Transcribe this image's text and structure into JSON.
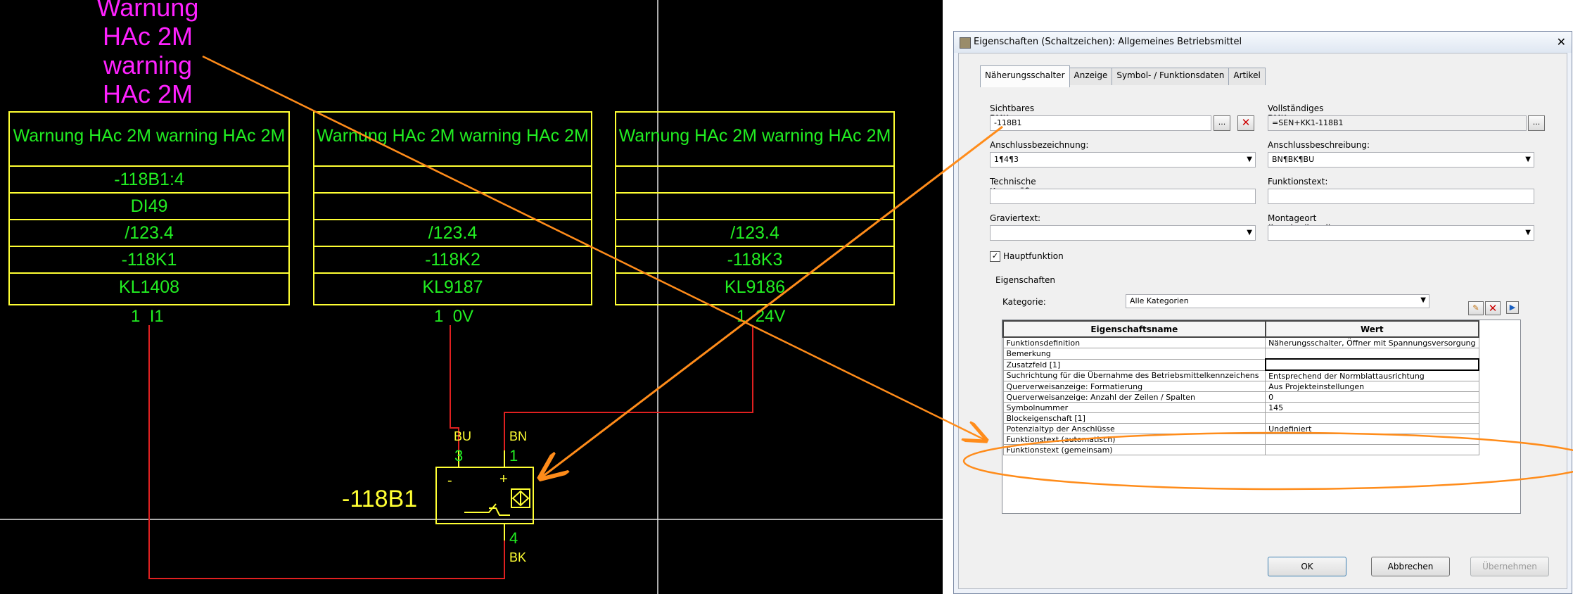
{
  "cad": {
    "warning_lines": [
      "Warnung",
      "HAc 2M",
      "warning",
      "HAc 2M"
    ],
    "terminals": [
      {
        "rows": [
          "Warnung HAc 2M warning HAc 2M",
          "-118B1:4",
          "DI49",
          "/123.4",
          "-118K1",
          "KL1408"
        ],
        "pin": "1",
        "signal": "I1"
      },
      {
        "rows": [
          "Warnung HAc 2M warning HAc 2M",
          "",
          "",
          "/123.4",
          "-118K2",
          "KL9187"
        ],
        "pin": "1",
        "signal": "0V"
      },
      {
        "rows": [
          "Warnung HAc 2M warning HAc 2M",
          "",
          "",
          "/123.4",
          "-118K3",
          "KL9186"
        ],
        "pin": "1",
        "signal": "24V"
      }
    ],
    "sensor": {
      "bmk": "-118B1",
      "minus": "-",
      "plus": "+",
      "pins": {
        "bu_label": "BU",
        "bu_num": "3",
        "bn_label": "BN",
        "bn_num": "1",
        "bk_num": "4",
        "bk_label": "BK"
      }
    },
    "colors": {
      "terminal_border": "#ffff33",
      "terminal_text": "#22ee22",
      "wire": "#e02020",
      "annotation": "#ff8c1a",
      "warning": "#ff22ff"
    }
  },
  "dialog": {
    "title": "Eigenschaften (Schaltzeichen): Allgemeines Betriebsmittel",
    "close_icon": "close-icon",
    "tabs": [
      "Näherungsschalter",
      "Anzeige",
      "Symbol- / Funktionsdaten",
      "Artikel"
    ],
    "active_tab": 0,
    "fields": {
      "sichtbares_bmk_label": "Sichtbares BMK:",
      "sichtbares_bmk_value": "-118B1",
      "vollstaendiges_bmk_label": "Vollständiges BMK:",
      "vollstaendiges_bmk_value": "=SEN+KK1-118B1",
      "anschlussbez_label": "Anschlussbezeichnung:",
      "anschlussbez_value": "1¶4¶3",
      "anschlussbeschr_label": "Anschlussbeschreibung:",
      "anschlussbeschr_value": "BN¶BK¶BU",
      "technische_label": "Technische Kenngrößen:",
      "technische_value": "",
      "funktionstext_label": "Funktionstext:",
      "funktionstext_value": "",
      "graviertext_label": "Graviertext:",
      "graviertext_value": "",
      "montageort_label": "Montageort (beschreibend):",
      "montageort_value": "",
      "ellipsis": "...",
      "hauptfunktion_label": "Hauptfunktion",
      "hauptfunktion_checked": true
    },
    "properties": {
      "section_label": "Eigenschaften",
      "kategorie_label": "Kategorie:",
      "kategorie_value": "Alle Kategorien",
      "columns": [
        "Eigenschaftsname",
        "Wert"
      ],
      "rows": [
        {
          "name": "Funktionsdefinition",
          "value": "Näherungsschalter, Öffner mit Spannungsversorgung"
        },
        {
          "name": "Bemerkung",
          "value": ""
        },
        {
          "name": "Zusatzfeld [1]",
          "value": ""
        },
        {
          "name": "Suchrichtung für die Übernahme des Betriebsmittelkennzeichens",
          "value": "Entsprechend der Normblattausrichtung"
        },
        {
          "name": "Querverweisanzeige: Formatierung",
          "value": "Aus Projekteinstellungen"
        },
        {
          "name": "Querverweisanzeige: Anzahl der Zeilen / Spalten",
          "value": "0"
        },
        {
          "name": "Symbolnummer",
          "value": "145"
        },
        {
          "name": "Blockeigenschaft [1]",
          "value": ""
        },
        {
          "name": "Potenzialtyp der Anschlüsse",
          "value": "Undefiniert"
        },
        {
          "name": "Funktionstext (automatisch)",
          "value": ""
        },
        {
          "name": "Funktionstext (gemeinsam)",
          "value": ""
        }
      ]
    },
    "buttons": {
      "ok": "OK",
      "cancel": "Abbrechen",
      "apply": "Übernehmen"
    }
  }
}
